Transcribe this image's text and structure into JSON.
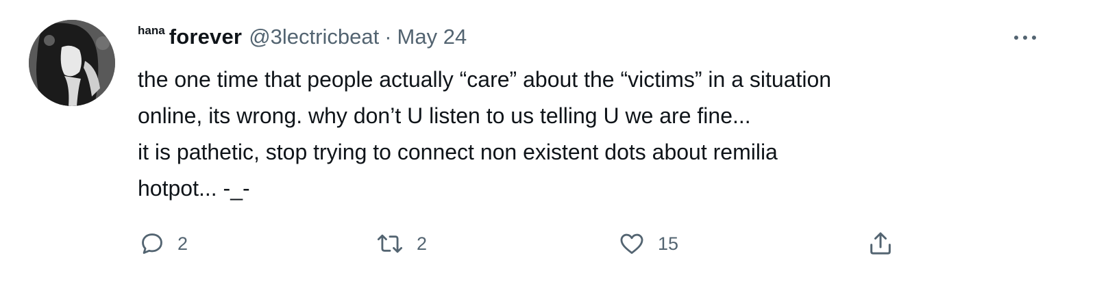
{
  "tweet": {
    "author": {
      "name_superscript": "hana",
      "name": "forever",
      "handle": "@3lectricbeat",
      "separator": "·",
      "date": "May 24"
    },
    "text_lines": [
      "the one time that people actually “care” about the “victims” in a situation",
      "online, its wrong. why don’t U listen to us telling U we are fine...",
      "it is pathetic, stop trying to connect non existent dots about remilia",
      "hotpot... -_-"
    ],
    "actions": {
      "reply": {
        "icon": "reply-icon",
        "count": "2"
      },
      "retweet": {
        "icon": "retweet-icon",
        "count": "2"
      },
      "like": {
        "icon": "heart-icon",
        "count": "15"
      },
      "share": {
        "icon": "share-icon",
        "count": ""
      }
    },
    "more_icon": "more-icon"
  }
}
